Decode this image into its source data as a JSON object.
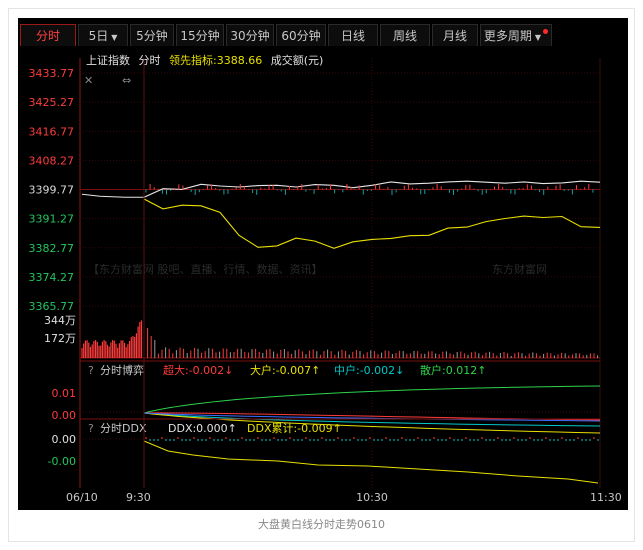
{
  "tabs": [
    {
      "label": "分时",
      "active": true
    },
    {
      "label": "5日",
      "caret": true
    },
    {
      "label": "5分钟"
    },
    {
      "label": "15分钟"
    },
    {
      "label": "30分钟"
    },
    {
      "label": "60分钟"
    },
    {
      "label": "日线"
    },
    {
      "label": "周线"
    },
    {
      "label": "月线"
    },
    {
      "label": "更多周期",
      "caret": true,
      "dot": true
    }
  ],
  "legend": {
    "index_name": "上证指数",
    "mode": "分时",
    "leading_label": "领先指标:3388.66",
    "turnover_label": "成交额(元)"
  },
  "watermark": {
    "left": "【东方财富网 股吧、直播、行情、数据、资讯】",
    "right": "东方财富网"
  },
  "price_axis": {
    "ticks": [
      "3433.77",
      "3425.27",
      "3416.77",
      "3408.27",
      "3399.77",
      "3391.27",
      "3382.77",
      "3374.27",
      "3365.77"
    ],
    "prev_close": 3399.77
  },
  "volume_axis": {
    "ticks": [
      "344万",
      "172万"
    ]
  },
  "game_panel": {
    "title": "分时博弈",
    "chaoda": "超大:-0.002↓",
    "dahu": "大户:-0.007↑",
    "zhonghu": "中户:-0.002↓",
    "sanhu": "散户:0.012↑",
    "ticks": [
      "0.01",
      "0.00"
    ]
  },
  "ddx_panel": {
    "title": "分时DDX",
    "ddx": "DDX:0.000↑",
    "ddx_cum": "DDX累计:-0.009↑",
    "ticks": [
      "0.00",
      "-0.00"
    ]
  },
  "time_axis": {
    "ticks": [
      "06/10",
      "9:30",
      "10:30",
      "11:30"
    ]
  },
  "caption": "大盘黄白线分时走势0610",
  "colors": {
    "up": "#ff3b3b",
    "down": "#22c55e",
    "white_line": "#e6e6e6",
    "yellow_line": "#e8e000",
    "cyan": "#00c8c8",
    "blue": "#3a6dff"
  },
  "chart_data": {
    "type": "line",
    "x_range": [
      "09:30",
      "11:30"
    ],
    "ylim": [
      3365.77,
      3433.77
    ],
    "prev_close": 3399.77,
    "series": [
      {
        "x": [
          "09:30",
          "09:35",
          "09:40",
          "09:45",
          "09:50",
          "09:55",
          "10:00",
          "10:05",
          "10:10",
          "10:15",
          "10:20",
          "10:25",
          "10:30",
          "10:35",
          "10:40",
          "10:45",
          "10:50",
          "10:55",
          "11:00",
          "11:05",
          "11:10",
          "11:15",
          "11:20",
          "11:25",
          "11:30"
        ],
        "values": [
          3397.5,
          3400.0,
          3399.8,
          3401.3,
          3400.8,
          3400.5,
          3400.9,
          3401.0,
          3400.5,
          3401.2,
          3401.0,
          3400.3,
          3401.0,
          3402.0,
          3401.4,
          3401.6,
          3402.0,
          3402.2,
          3401.9,
          3401.6,
          3402.0,
          3401.5,
          3401.7,
          3402.2,
          3401.9
        ]
      },
      {
        "x": [
          "09:30",
          "09:35",
          "09:40",
          "09:45",
          "09:50",
          "09:55",
          "10:00",
          "10:05",
          "10:10",
          "10:15",
          "10:20",
          "10:25",
          "10:30",
          "10:35",
          "10:40",
          "10:45",
          "10:50",
          "10:55",
          "11:00",
          "11:05",
          "11:10",
          "11:15",
          "11:20",
          "11:25",
          "11:30"
        ],
        "values": [
          3397.0,
          3394.1,
          3395.2,
          3395.0,
          3393.1,
          3386.4,
          3382.9,
          3383.3,
          3385.6,
          3384.7,
          3382.6,
          3384.5,
          3385.2,
          3385.5,
          3386.3,
          3386.4,
          3388.5,
          3388.8,
          3390.4,
          3391.3,
          3392.0,
          3391.6,
          3391.9,
          3388.9,
          3388.7
        ]
      }
    ]
  }
}
